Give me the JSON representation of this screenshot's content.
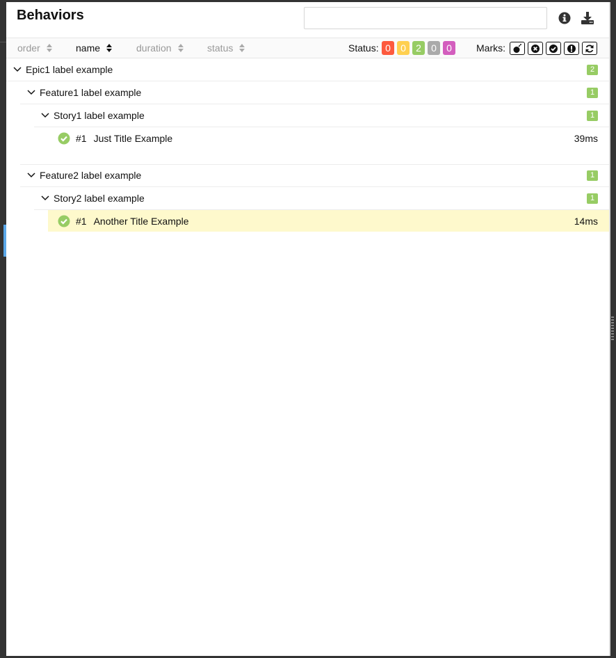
{
  "panel": {
    "title": "Behaviors",
    "search": {
      "value": "",
      "placeholder": ""
    }
  },
  "toolbar": {
    "sorters": [
      {
        "label": "order",
        "active": false
      },
      {
        "label": "name",
        "active": true
      },
      {
        "label": "duration",
        "active": false
      },
      {
        "label": "status",
        "active": false
      }
    ],
    "status_label": "Status:",
    "status_counts": [
      {
        "status": "failed",
        "value": "0",
        "color": "#fd5a3e"
      },
      {
        "status": "broken",
        "value": "0",
        "color": "#ffd050"
      },
      {
        "status": "passed",
        "value": "2",
        "color": "#97cc64"
      },
      {
        "status": "skipped",
        "value": "0",
        "color": "#aaaaaa"
      },
      {
        "status": "unknown",
        "value": "0",
        "color": "#d35ebe"
      }
    ],
    "marks_label": "Marks:",
    "marks": [
      "bomb-icon",
      "times-circle-icon",
      "check-circle-icon",
      "exclamation-circle-icon",
      "refresh-icon"
    ]
  },
  "tree": {
    "epic1": {
      "label": "Epic1 label example",
      "count": "2"
    },
    "feature1": {
      "label": "Feature1 label example",
      "count": "1"
    },
    "story1": {
      "label": "Story1 label example",
      "count": "1"
    },
    "test1": {
      "num": "#1",
      "name": "Just Title Example",
      "duration": "39ms"
    },
    "feature2": {
      "label": "Feature2 label example",
      "count": "1"
    },
    "story2": {
      "label": "Story2 label example",
      "count": "1"
    },
    "test2": {
      "num": "#1",
      "name": "Another Title Example",
      "duration": "14ms",
      "selected": true
    }
  }
}
